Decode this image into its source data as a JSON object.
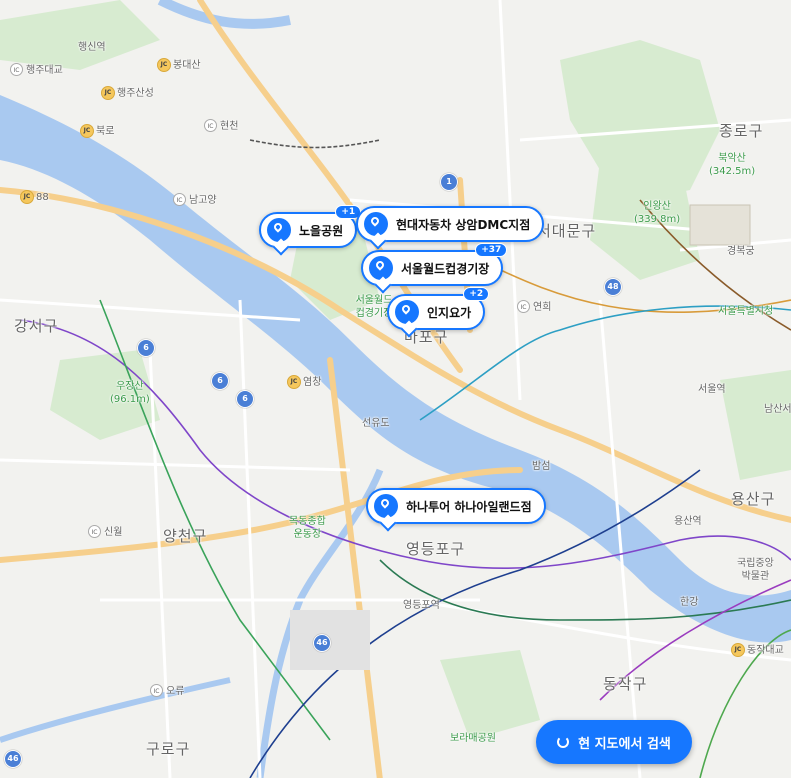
{
  "colors": {
    "water": "#a9c9f0",
    "park": "#cfe8c8",
    "road_major": "#f6cf8c",
    "road_minor": "#ffffff",
    "accent": "#1677ff"
  },
  "places": {
    "haengsin_station": "행신역",
    "haengju_daegyo": "행주대교",
    "bonghwasan": "봉대산",
    "haengju_sanseong": "행주산성",
    "bungno": "북로",
    "hyeoncheon": "현천",
    "namgoyang": "남고양",
    "jc_88": "88",
    "jongno": "종로구",
    "bugaksan_name": "북악산",
    "bugaksan_height": "(342.5m)",
    "inwangsan_name": "인왕산",
    "inwangsan_height": "(339.8m)",
    "seodaemun": "서대문구",
    "gyeongbokgung": "경복궁",
    "seoul_city_hall": "서울특별시청",
    "seoul_station": "서울역",
    "namsan": "남산서",
    "gangseo": "강서구",
    "mapo": "마포구",
    "yeonhui": "연희",
    "world_cup_stadium_lbl": "서울월드컵경기장",
    "ujangsan_name": "우장산",
    "ujangsan_height": "(96.1m)",
    "yeomchang": "염창",
    "seonyudo": "선유도",
    "bamseom": "밤섬",
    "yongsan": "용산구",
    "yongsan_station": "용산역",
    "mokdong_name": "목동종합",
    "mokdong_sub": "운동장",
    "sinwol": "신월",
    "yangcheon": "양천구",
    "yeongdeungpo": "영등포구",
    "yeongdeungpo_station": "영등포역",
    "national_museum_1": "국립중앙",
    "national_museum_2": "박물관",
    "hangang": "한강",
    "dongjak_daegyo": "동작대교",
    "ori": "오류",
    "guro": "구로구",
    "dongjak": "동작구",
    "boramae": "보라매공원"
  },
  "route_shields": [
    "1",
    "48",
    "6",
    "6",
    "6",
    "46",
    "46"
  ],
  "markers": [
    {
      "label": "노을공원",
      "badge": "+1"
    },
    {
      "label": "현대자동차 상암DMC지점",
      "badge": ""
    },
    {
      "label": "서울월드컵경기장",
      "badge": "+37"
    },
    {
      "label": "인지요가",
      "badge": "+2"
    },
    {
      "label": "하나투어 하나아일랜드점",
      "badge": ""
    }
  ],
  "search_button": {
    "label": "현 지도에서 검색",
    "icon": "refresh-icon"
  }
}
